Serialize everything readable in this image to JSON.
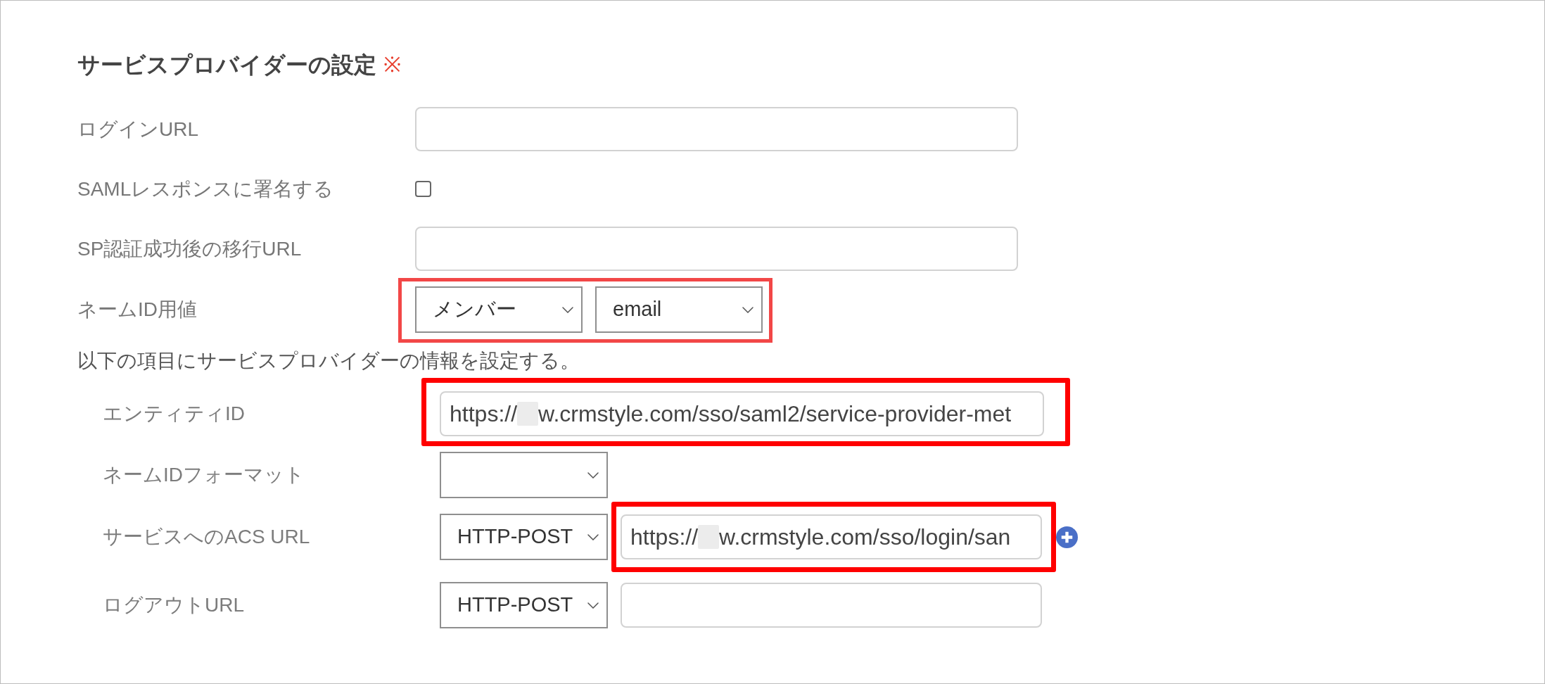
{
  "section": {
    "title": "サービスプロバイダーの設定",
    "required_mark": "※"
  },
  "fields": [
    {
      "kind": "text",
      "label": "ログインURL",
      "highlighted": false
    },
    {
      "kind": "checkbox",
      "label": "SAMLレスポンスに署名する",
      "checked": false,
      "highlighted": false
    },
    {
      "kind": "text",
      "label": "SP認証成功後の移行URL",
      "highlighted": false
    },
    {
      "kind": "select_pair",
      "label": "ネームID用値",
      "selects": [
        "メンバー",
        "email"
      ],
      "highlighted": true
    }
  ],
  "note": "以下の項目にサービスプロバイダーの情報を設定する。",
  "sp_fields": [
    {
      "kind": "text",
      "label": "エンティティID",
      "value": {
        "before_blur": "https://",
        "after_blur": "w.crmstyle.com/sso/saml2/service-provider-met"
      },
      "highlighted": true
    },
    {
      "kind": "select",
      "label": "ネームIDフォーマット",
      "highlighted": false
    },
    {
      "kind": "binding_url",
      "label": "サービスへのACS URL",
      "binding": "HTTP-POST",
      "value": {
        "before_blur": "https://",
        "after_blur": "w.crmstyle.com/sso/login/san"
      },
      "add_button": true,
      "highlighted": true
    },
    {
      "kind": "binding_url",
      "label": "ログアウトURL",
      "binding": "HTTP-POST",
      "add_button": false,
      "highlighted": false
    }
  ]
}
